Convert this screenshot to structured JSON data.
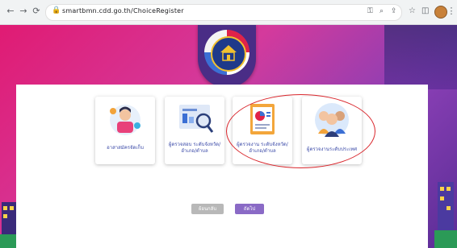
{
  "browser": {
    "url": "smartbmn.cdd.go.th/ChoiceRegister",
    "icons": [
      "back-icon",
      "forward-icon",
      "reload-icon",
      "lock-icon",
      "key-icon",
      "zoom-icon",
      "share-icon",
      "star-icon",
      "extension-icon",
      "profile-avatar",
      "menu-icon"
    ]
  },
  "cards": [
    {
      "label": "อาสาสมัครจัดเก็บ"
    },
    {
      "label": "ผู้ตรวจสอบ ระดับจังหวัด/อำเภอ/ตำบล"
    },
    {
      "label": "ผู้ตรวจงาน ระดับจังหวัด/อำเภอ/ตำบล"
    },
    {
      "label": "ผู้ตรวจงานระดับประเทศ"
    }
  ],
  "buttons": {
    "back": "ย้อนกลับ",
    "next": "ถัดไป"
  },
  "colors": {
    "accent_purple": "#8a6ac6",
    "highlight_ellipse": "#d9262c",
    "label_blue": "#3b4aa8"
  }
}
